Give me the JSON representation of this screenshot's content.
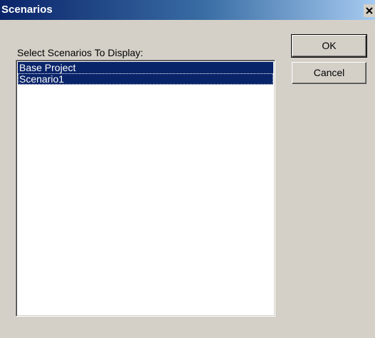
{
  "window": {
    "title": "Scenarios",
    "close_icon": "close-icon",
    "title_bar_color": "#0a246a",
    "face_color": "#d4d0c8"
  },
  "list": {
    "label": "Select Scenarios To Display:",
    "items": [
      {
        "label": "Base Project",
        "selected": true
      },
      {
        "label": "Scenario1",
        "selected": true
      }
    ],
    "selection_color": "#0a246a"
  },
  "buttons": {
    "ok_label": "OK",
    "cancel_label": "Cancel"
  }
}
